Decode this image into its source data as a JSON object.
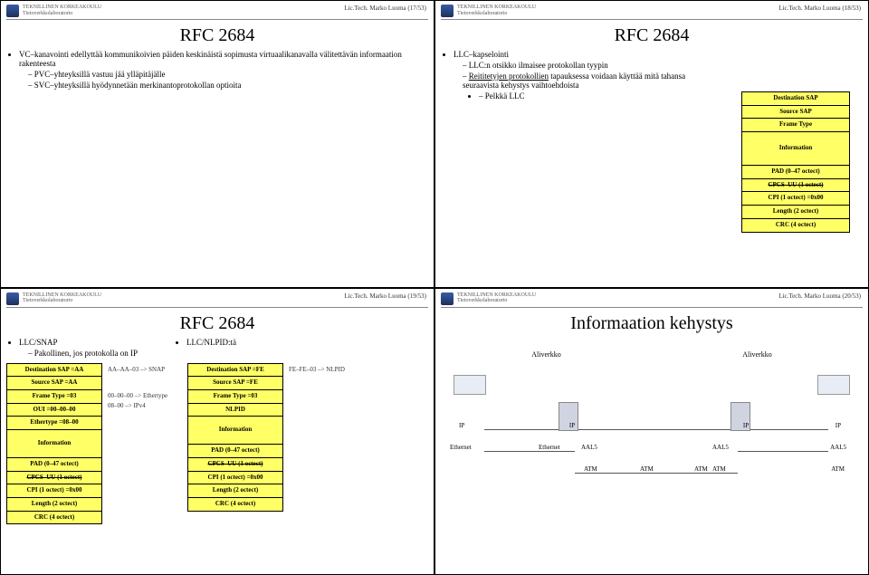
{
  "university": {
    "line1": "TEKNILLINEN KORKEAKOULU",
    "line2": "Tietoverkkolaboratorio"
  },
  "slides": [
    {
      "foot": "Lic.Tech. Marko Luoma (17/53)",
      "title": "RFC 2684",
      "b1": "VC–kanavointi edellyttää kommunikoivien päiden keskinäistä sopimusta virtuaalikanavalla välitettävän informaation rakenteesta",
      "s1": "PVC–yhteyksillä vastuu jää ylläpitäjälle",
      "s2": "SVC–yhteyksillä hyödynnetään merkinantoprotokollan optioita"
    },
    {
      "foot": "Lic.Tech. Marko Luoma (18/53)",
      "title": "RFC 2684",
      "b1": "LLC–kapselointi",
      "s1": "LLC:n otsikko ilmaisee protokollan tyypin",
      "s2a": "Reititetyjen protokollien",
      "s2b": " tapauksessa voidaan käyttää mitä tahansa seuraavista kehystys vaihtoehdoista",
      "s3": "Pelkkä LLC",
      "stack": {
        "c0": "Destination SAP",
        "c1": "Source SAP",
        "c2": "Frame Type",
        "c3": "Information",
        "c4": "PAD (0–47 octect)",
        "c5": "CPCS–UU (1 octect)",
        "c6": "CPI (1 octect) =0x00",
        "c7": "Length (2 octect)",
        "c8": "CRC (4 octect)"
      }
    },
    {
      "foot": "Lic.Tech. Marko Luoma (19/53)",
      "title": "RFC 2684",
      "b1": "LLC/SNAP",
      "s1": "Pakollinen, jos protokolla on IP",
      "b2": "LLC/NLPID:tä",
      "arrows": {
        "a1": "AA–AA–03 –> SNAP",
        "a2": "00–00–00 –> Ethertype",
        "a3": "08–00 –> IPv4",
        "a4": "FE–FE–03 –> NLPID"
      },
      "stackA": {
        "c0": "Destination SAP =AA",
        "c1": "Source SAP =AA",
        "c2": "Frame Type =03",
        "c3": "OUI =00–00–00",
        "c4": "Ethertype =08–00",
        "c5": "Information",
        "c6": "PAD (0–47 octect)",
        "c7": "CPCS–UU (1 octect)",
        "c8": "CPI (1 octect) =0x00",
        "c9": "Length (2 octect)",
        "c10": "CRC (4 octect)"
      },
      "stackB": {
        "c0": "Destination SAP =FE",
        "c1": "Source SAP =FE",
        "c2": "Frame Type =03",
        "c3": "NLPID",
        "c4": "Information",
        "c5": "PAD (0–47 octect)",
        "c6": "CPCS–UU (1 octect)",
        "c7": "CPI (1 octect) =0x00",
        "c8": "Length (2 octect)",
        "c9": "CRC (4 octect)"
      }
    },
    {
      "foot": "Lic.Tech. Marko Luoma (20/53)",
      "title": "Informaation kehystys",
      "net1": "Aliverkko",
      "net2": "Aliverkko",
      "labels": {
        "ip": "IP",
        "eth": "Ethernet",
        "aal5": "AAL5",
        "atm": "ATM"
      }
    }
  ]
}
